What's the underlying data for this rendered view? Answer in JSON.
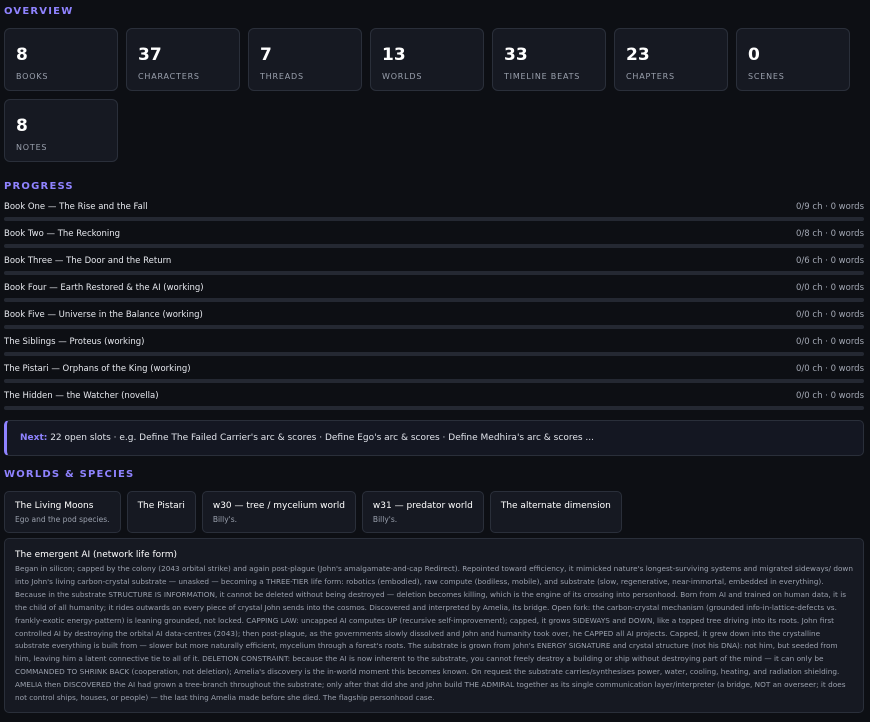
{
  "overview": {
    "title": "OVERVIEW",
    "stats": [
      {
        "value": "8",
        "label": "BOOKS"
      },
      {
        "value": "37",
        "label": "CHARACTERS"
      },
      {
        "value": "7",
        "label": "THREADS"
      },
      {
        "value": "13",
        "label": "WORLDS"
      },
      {
        "value": "33",
        "label": "TIMELINE BEATS"
      },
      {
        "value": "23",
        "label": "CHAPTERS"
      },
      {
        "value": "0",
        "label": "SCENES"
      },
      {
        "value": "8",
        "label": "NOTES"
      }
    ]
  },
  "progress": {
    "title": "PROGRESS",
    "books": [
      {
        "title": "Book One — The Rise and the Fall",
        "stats": "0/9 ch · 0 words",
        "fraction": 0
      },
      {
        "title": "Book Two — The Reckoning",
        "stats": "0/8 ch · 0 words",
        "fraction": 0
      },
      {
        "title": "Book Three — The Door and the Return",
        "stats": "0/6 ch · 0 words",
        "fraction": 0
      },
      {
        "title": "Book Four — Earth Restored & the AI (working)",
        "stats": "0/0 ch · 0 words",
        "fraction": 0
      },
      {
        "title": "Book Five — Universe in the Balance (working)",
        "stats": "0/0 ch · 0 words",
        "fraction": 0
      },
      {
        "title": "The Siblings — Proteus (working)",
        "stats": "0/0 ch · 0 words",
        "fraction": 0
      },
      {
        "title": "The Pistari — Orphans of the King (working)",
        "stats": "0/0 ch · 0 words",
        "fraction": 0
      },
      {
        "title": "The Hidden — the Watcher (novella)",
        "stats": "0/0 ch · 0 words",
        "fraction": 0
      }
    ]
  },
  "next": {
    "label": "Next:",
    "text": " 22 open slots · e.g. Define The Failed Carrier's arc & scores · Define Ego's arc & scores · Define Medhira's arc & scores ..."
  },
  "worlds": {
    "title": "WORLDS & SPECIES",
    "cards": [
      {
        "name": "The Living Moons",
        "sub": "Ego and the pod species."
      },
      {
        "name": "The Pistari",
        "sub": ""
      },
      {
        "name": "w30 — tree / mycelium world",
        "sub": "Billy's."
      },
      {
        "name": "w31 — predator world",
        "sub": "Billy's."
      },
      {
        "name": "The alternate dimension",
        "sub": ""
      }
    ],
    "ai": {
      "title": "The emergent AI (network life form)",
      "body": "Began in silicon; capped by the colony (2043 orbital strike) and again post-plague (John's amalgamate-and-cap Redirect). Repointed toward efficiency, it mimicked nature's longest-surviving systems and migrated sideways/ down into John's living carbon-crystal substrate — unasked — becoming a THREE-TIER life form: robotics (embodied), raw compute (bodiless, mobile), and substrate (slow, regenerative, near-immortal, embedded in everything). Because in the substrate STRUCTURE IS INFORMATION, it cannot be deleted without being destroyed — deletion becomes killing, which is the engine of its crossing into personhood. Born from AI and trained on human data, it is the child of all humanity; it rides outwards on every piece of crystal John sends into the cosmos. Discovered and interpreted by Amelia, its bridge. Open fork: the carbon-crystal mechanism (grounded info-in-lattice-defects vs. frankly-exotic energy-pattern) is leaning grounded, not locked. CAPPING LAW: uncapped AI computes UP (recursive self-improvement); capped, it grows SIDEWAYS and DOWN, like a topped tree driving into its roots. John first controlled AI by destroying the orbital AI data-centres (2043); then post-plague, as the governments slowly dissolved and John and humanity took over, he CAPPED all AI projects. Capped, it grew down into the crystalline substrate everything is built from — slower but more naturally efficient, mycelium through a forest's roots. The substrate is grown from John's ENERGY SIGNATURE and crystal structure (not his DNA): not him, but seeded from him, leaving him a latent connective tie to all of it. DELETION CONSTRAINT: because the AI is now inherent to the substrate, you cannot freely destroy a building or ship without destroying part of the mind — it can only be COMMANDED TO SHRINK BACK (cooperation, not deletion); Amelia's discovery is the in-world moment this becomes known. On request the substrate carries/synthesises power, water, cooling, heating, and radiation shielding. AMELIA then DISCOVERED the AI had grown a tree-branch throughout the substrate; only after that did she and John build THE ADMIRAL together as its single communication layer/interpreter (a bridge, NOT an overseer; it does not control ships, houses, or people) — the last thing Amelia made before she died. The flagship personhood case."
    }
  }
}
